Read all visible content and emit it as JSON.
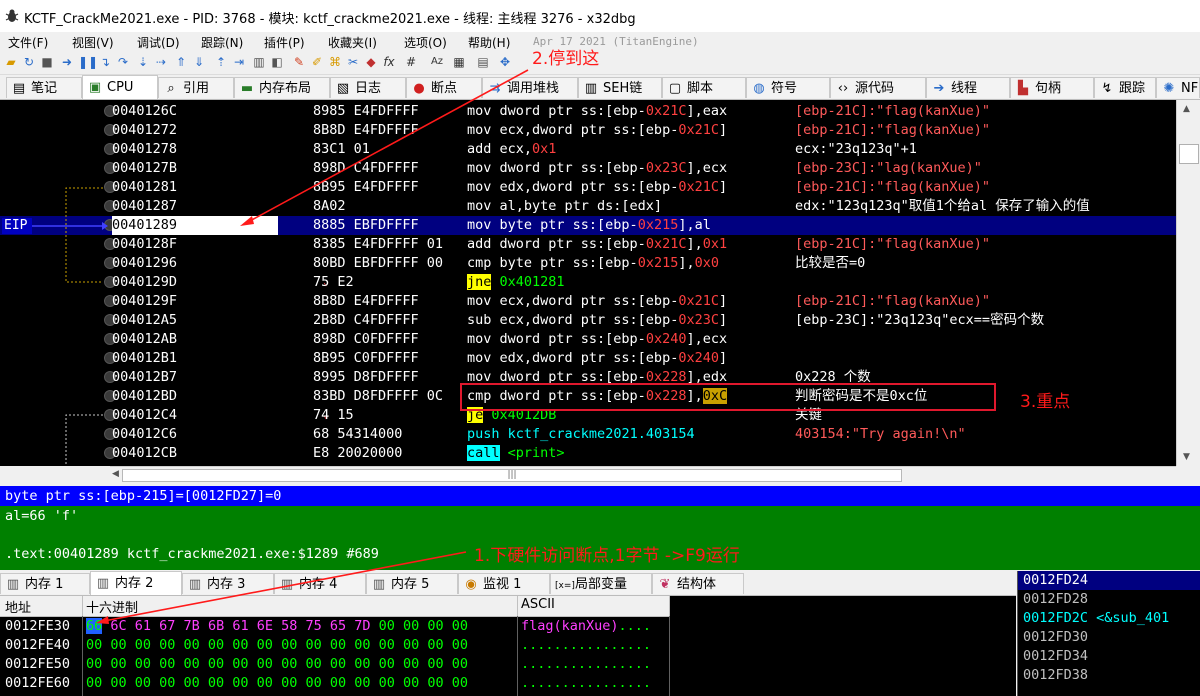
{
  "title": "KCTF_CrackMe2021.exe - PID: 3768 - 模块: kctf_crackme2021.exe - 线程: 主线程 3276 - x32dbg",
  "menu": [
    "文件(F)",
    "视图(V)",
    "调试(D)",
    "跟踪(N)",
    "插件(P)",
    "收藏夹(I)",
    "选项(O)",
    "帮助(H)"
  ],
  "version": "Apr 17 2021 (TitanEngine)",
  "tabs": [
    {
      "label": "笔记",
      "icon": "note-icon"
    },
    {
      "label": "CPU",
      "icon": "cpu-icon"
    },
    {
      "label": "引用",
      "icon": "search-icon"
    },
    {
      "label": "内存布局",
      "icon": "memory-map-icon"
    },
    {
      "label": "日志",
      "icon": "log-icon"
    },
    {
      "label": "断点",
      "icon": "breakpoint-icon"
    },
    {
      "label": "调用堆栈",
      "icon": "call-stack-icon"
    },
    {
      "label": "SEH链",
      "icon": "seh-icon"
    },
    {
      "label": "脚本",
      "icon": "script-icon"
    },
    {
      "label": "符号",
      "icon": "symbol-icon"
    },
    {
      "label": "源代码",
      "icon": "source-icon"
    },
    {
      "label": "线程",
      "icon": "thread-icon"
    },
    {
      "label": "句柄",
      "icon": "handle-icon"
    },
    {
      "label": "跟踪",
      "icon": "trace-icon"
    },
    {
      "label": "NFO",
      "icon": "gear-icon"
    }
  ],
  "eip_label": "EIP",
  "disasm": [
    {
      "addr": "0040126C",
      "bytes": "8985 E4FDFFFF",
      "instr": "mov dword ptr ss:[ebp-0x21C],eax",
      "comment": "[ebp-21C]:\"flag(kanXue)\""
    },
    {
      "addr": "00401272",
      "bytes": "8B8D E4FDFFFF",
      "instr": "mov ecx,dword ptr ss:[ebp-0x21C]",
      "comment": "[ebp-21C]:\"flag(kanXue)\""
    },
    {
      "addr": "00401278",
      "bytes": "83C1 01",
      "instr": "add ecx,0x1",
      "comment": "ecx:\"23q123q\"+1"
    },
    {
      "addr": "0040127B",
      "bytes": "898D C4FDFFFF",
      "instr": "mov dword ptr ss:[ebp-0x23C],ecx",
      "comment": "[ebp-23C]:\"lag(kanXue)\""
    },
    {
      "addr": "00401281",
      "bytes": "8B95 E4FDFFFF",
      "instr": "mov edx,dword ptr ss:[ebp-0x21C]",
      "comment": "[ebp-21C]:\"flag(kanXue)\""
    },
    {
      "addr": "00401287",
      "bytes": "8A02",
      "instr": "mov al,byte ptr ds:[edx]",
      "comment": "edx:\"123q123q\"取值1个给al 保存了输入的值"
    },
    {
      "addr": "00401289",
      "bytes": "8885 EBFDFFFF",
      "instr": "mov byte ptr ss:[ebp-0x215],al",
      "comment": ""
    },
    {
      "addr": "0040128F",
      "bytes": "8385 E4FDFFFF 01",
      "instr": "add dword ptr ss:[ebp-0x21C],0x1",
      "comment": "[ebp-21C]:\"flag(kanXue)\""
    },
    {
      "addr": "00401296",
      "bytes": "80BD EBFDFFFF 00",
      "instr": "cmp byte ptr ss:[ebp-0x215],0x0",
      "comment": "比较是否=0"
    },
    {
      "addr": "0040129D",
      "bytes": "75 E2",
      "instr": "jne 0x401281",
      "comment": ""
    },
    {
      "addr": "0040129F",
      "bytes": "8B8D E4FDFFFF",
      "instr": "mov ecx,dword ptr ss:[ebp-0x21C]",
      "comment": "[ebp-21C]:\"flag(kanXue)\""
    },
    {
      "addr": "004012A5",
      "bytes": "2B8D C4FDFFFF",
      "instr": "sub ecx,dword ptr ss:[ebp-0x23C]",
      "comment": "[ebp-23C]:\"23q123q\"ecx==密码个数"
    },
    {
      "addr": "004012AB",
      "bytes": "898D C0FDFFFF",
      "instr": "mov dword ptr ss:[ebp-0x240],ecx",
      "comment": ""
    },
    {
      "addr": "004012B1",
      "bytes": "8B95 C0FDFFFF",
      "instr": "mov edx,dword ptr ss:[ebp-0x240]",
      "comment": ""
    },
    {
      "addr": "004012B7",
      "bytes": "8995 D8FDFFFF",
      "instr": "mov dword ptr ss:[ebp-0x228],edx",
      "comment": "0x228 个数"
    },
    {
      "addr": "004012BD",
      "bytes": "83BD D8FDFFFF 0C",
      "instr": "cmp dword ptr ss:[ebp-0x228],0xC",
      "comment": "判断密码是不是0xc位"
    },
    {
      "addr": "004012C4",
      "bytes": "74 15",
      "instr": "je 0x4012DB",
      "comment": "关键"
    },
    {
      "addr": "004012C6",
      "bytes": "68 54314000",
      "instr": "push kctf_crackme2021.403154",
      "comment": "403154:\"Try again!\\n\""
    },
    {
      "addr": "004012CB",
      "bytes": "E8 20020000",
      "instr": "call <print>",
      "comment": ""
    }
  ],
  "info_line": "byte ptr ss:[ebp-215]=[0012FD27]=0",
  "info_panel": [
    "al=66 'f'",
    "",
    ".text:00401289 kctf_crackme2021.exe:$1289 #689"
  ],
  "bottom_tabs": [
    {
      "label": "内存 1",
      "icon": "memory-icon"
    },
    {
      "label": "内存 2",
      "icon": "memory-icon"
    },
    {
      "label": "内存 3",
      "icon": "memory-icon"
    },
    {
      "label": "内存 4",
      "icon": "memory-icon"
    },
    {
      "label": "内存 5",
      "icon": "memory-icon"
    },
    {
      "label": "监视 1",
      "icon": "watch-icon"
    },
    {
      "label": "局部变量",
      "icon": "locals-icon"
    },
    {
      "label": "结构体",
      "icon": "struct-icon"
    }
  ],
  "memory_headers": {
    "address": "地址",
    "hex": "十六进制",
    "ascii": "ASCII"
  },
  "memory_rows": [
    {
      "addr": "0012FE30",
      "hex": "66 6C 61 67 7B 6B 61 6E 58 75 65 7D 00 00 00 00",
      "ascii": "flag(kanXue)...."
    },
    {
      "addr": "0012FE40",
      "hex": "00 00 00 00 00 00 00 00 00 00 00 00 00 00 00 00",
      "ascii": "................"
    },
    {
      "addr": "0012FE50",
      "hex": "00 00 00 00 00 00 00 00 00 00 00 00 00 00 00 00",
      "ascii": "................"
    },
    {
      "addr": "0012FE60",
      "hex": "00 00 00 00 00 00 00 00 00 00 00 00 00 00 00 00",
      "ascii": "................"
    }
  ],
  "stack_rows": [
    "0012FD24",
    "0012FD28",
    "0012FD2C <&sub_401",
    "0012FD30",
    "0012FD34",
    "0012FD38"
  ],
  "annotations": {
    "a1": "1.下硬件访问断点,1字节     ->F9运行",
    "a2": "2.停到这",
    "a3": "3.重点"
  },
  "colors": {
    "background": "#000000",
    "current_line": "#000080",
    "eip": "#0000c0",
    "info_bar": "#0000ff",
    "info_panel": "#008000",
    "annotation": "#ff1a1a",
    "number": "#ff4040",
    "immediate": "#00ff00"
  }
}
